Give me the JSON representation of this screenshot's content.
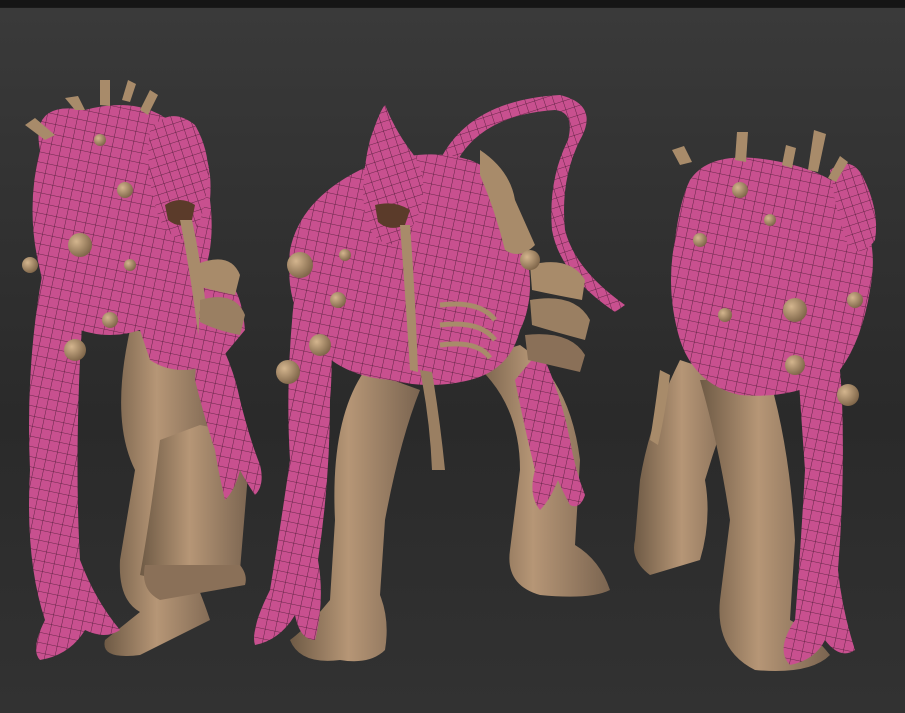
{
  "viewport": {
    "label": "",
    "background_color": "#343434",
    "top_strip_color": "#151515"
  },
  "materials": {
    "skin_color": "#c8508f",
    "skin_shadow": "#8f2e63",
    "wire_color": "#4a1a33",
    "armor_color": "#a88b6a",
    "armor_shadow": "#6e5a45",
    "armor_light": "#c7a884"
  },
  "figures": [
    {
      "id": "front",
      "view": "front"
    },
    {
      "id": "three-quarter",
      "view": "three-quarter"
    },
    {
      "id": "back",
      "view": "back"
    }
  ]
}
